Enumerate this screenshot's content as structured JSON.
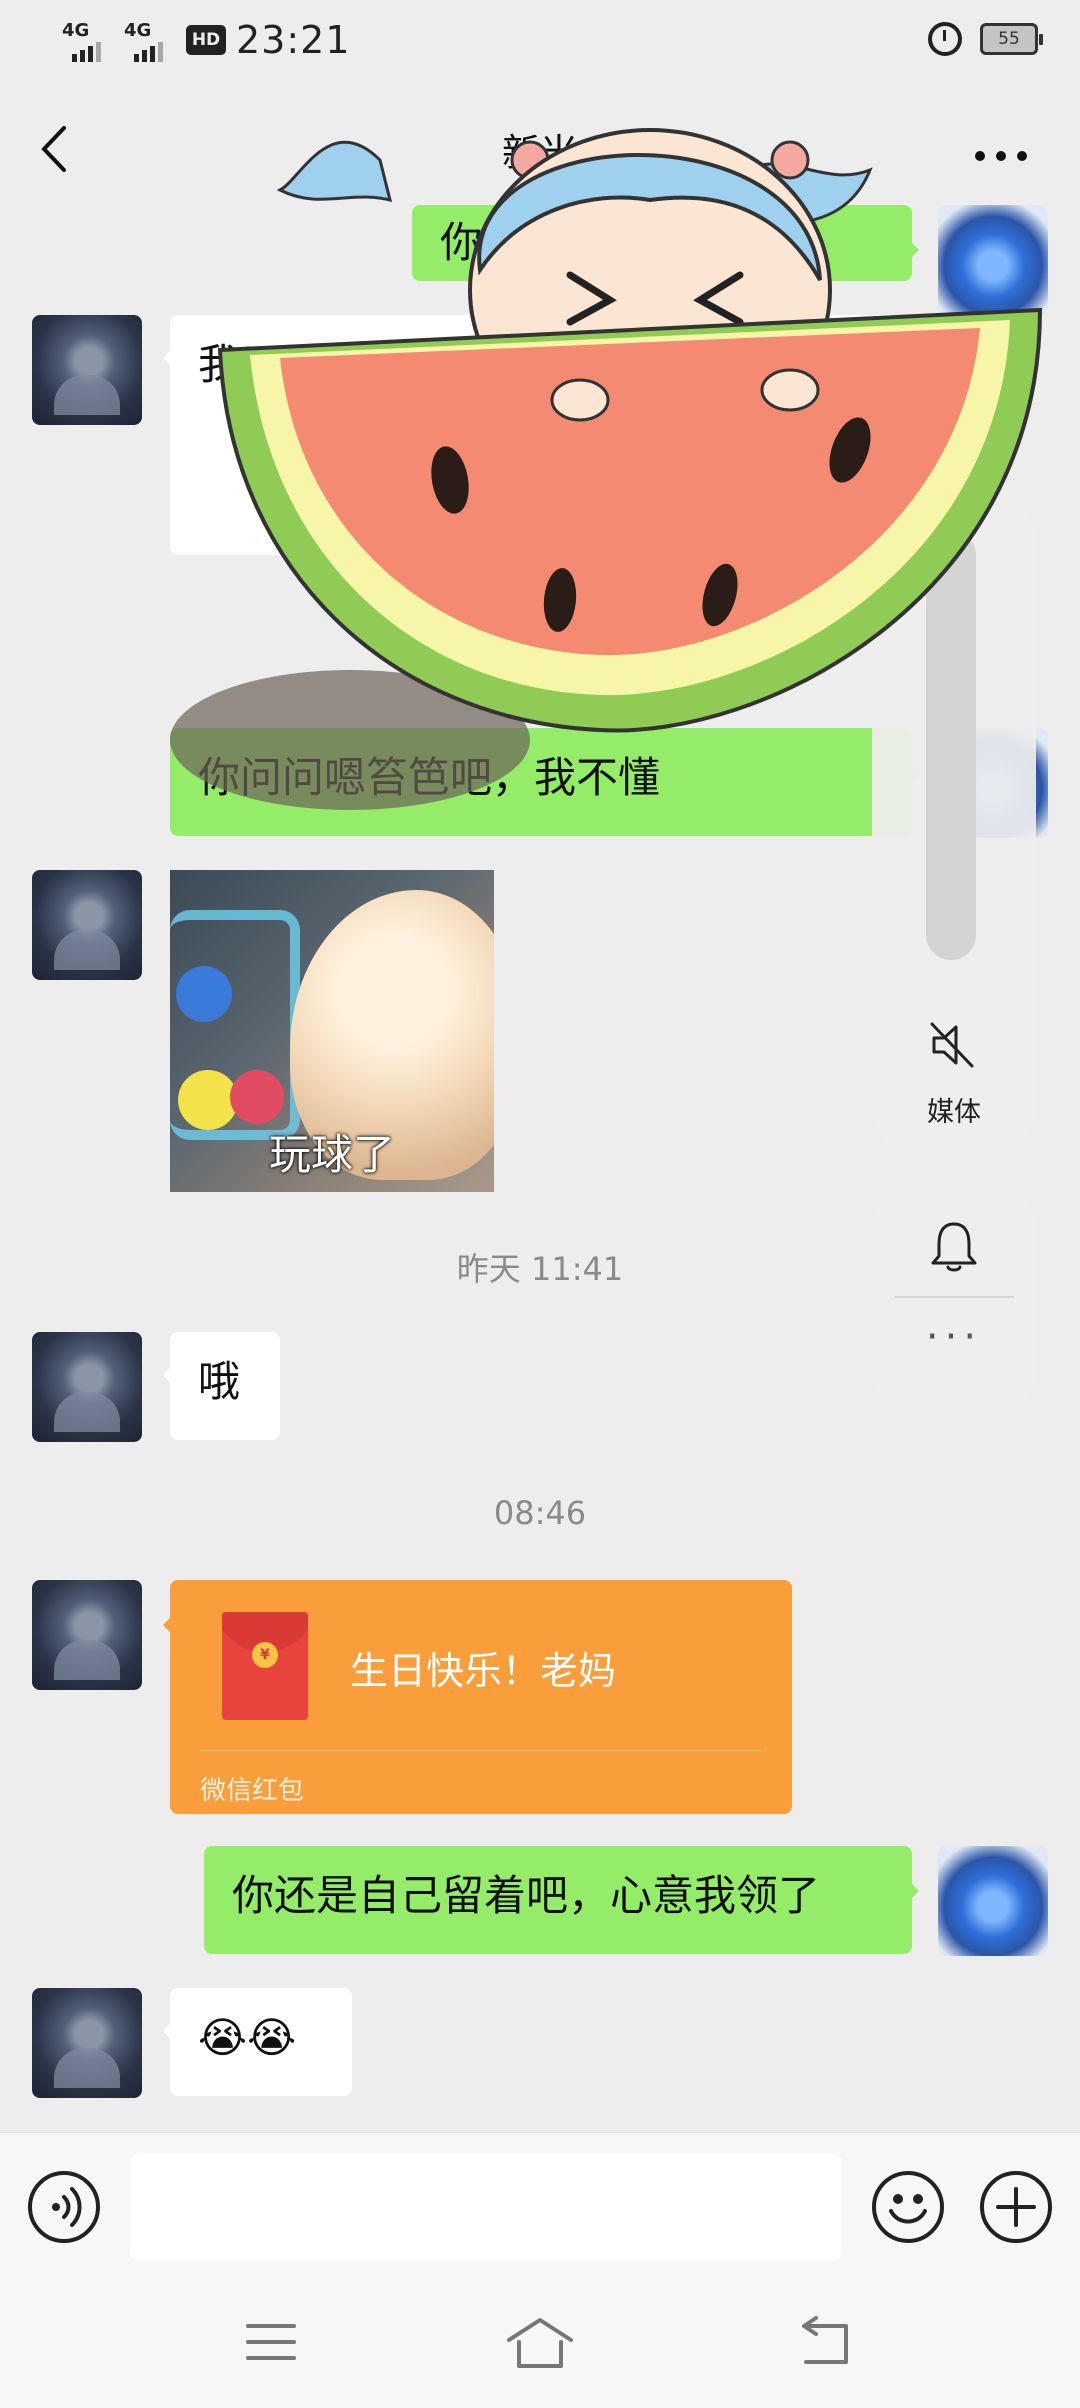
{
  "status_bar": {
    "signal_1": "4G",
    "signal_2": "4G",
    "hd": "HD",
    "time": "23:21",
    "battery": "55"
  },
  "header": {
    "title": "新米"
  },
  "messages": {
    "m1_text": "你自己搭？",
    "m2_text": "我只是看着上一下了挡着物",
    "m3_text": "你问问嗯笞笆吧，我不懂",
    "sticker_caption": "玩球了",
    "timestamp_1": "昨天 11:41",
    "m5_text": "哦",
    "timestamp_2": "08:46",
    "red_packet_title": "生日快乐！老妈",
    "red_packet_label": "微信红包",
    "red_packet_coin": "¥",
    "m7_text": "你还是自己留着吧，心意我领了",
    "m8_text": "😭😭"
  },
  "volume_panel": {
    "media_label": "媒体",
    "more": "···"
  },
  "input_bar": {
    "placeholder": ""
  },
  "colors": {
    "background": "#ededed",
    "bubble_green": "#95ec69",
    "bubble_white": "#ffffff",
    "red_packet": "#fa9d3b"
  }
}
